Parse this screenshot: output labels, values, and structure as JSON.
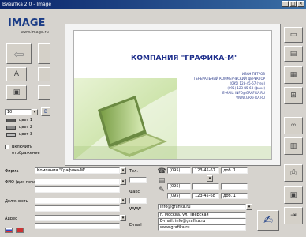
{
  "window": {
    "title": "Визитка 2.0 - Image"
  },
  "logo": {
    "title": "IMAGE",
    "subtitle": "www.image.ru"
  },
  "card": {
    "company": "КОМПАНИЯ \"ГРАФИКА-М\"",
    "lines": [
      "ИВАН ПЕТРОВ",
      "ГЕНЕРАЛЬНЫЙ КОММЕРЧЕСКИЙ ДИРЕКТОР",
      "(095) 123-45-67 (тел)",
      "(095) 123-45-68 (факс)",
      "E-MAIL: INFO@GRAFIKA.RU",
      "WWW.GRAFIKA.RU"
    ]
  },
  "left_panel": {
    "font_size": "10",
    "color_rows": [
      "цвет 1",
      "цвет 2",
      "цвет 3"
    ],
    "checkbox1_label": "Включить",
    "checkbox2_label": "отображение"
  },
  "form": {
    "name_label": "Фирма",
    "name_value": "Компания \"Графика-М\"",
    "person_label": "ФИО (для печати)",
    "position_label": "Должность",
    "address_label": "Адрес",
    "tel_label": "Тел.",
    "fax_label": "Факс",
    "mail_label": "E-mail",
    "web_label": "WWW",
    "phone_rows": [
      {
        "code": "(095)",
        "num": "123-45-67",
        "ext": "доб. 1"
      },
      {
        "code": "(095)",
        "num": "",
        "ext": ""
      },
      {
        "code": "(095)",
        "num": "123-45-68",
        "ext": "доб. 1"
      }
    ],
    "email_value": "info@grafika.ru",
    "address_lines": [
      "г. Москва, ул. Тверская",
      "E-mail: info@grafika.ru",
      "www.grafika.ru"
    ]
  },
  "colors": {
    "accent": "#1e2f8c",
    "titlebar": "#0a246a"
  }
}
